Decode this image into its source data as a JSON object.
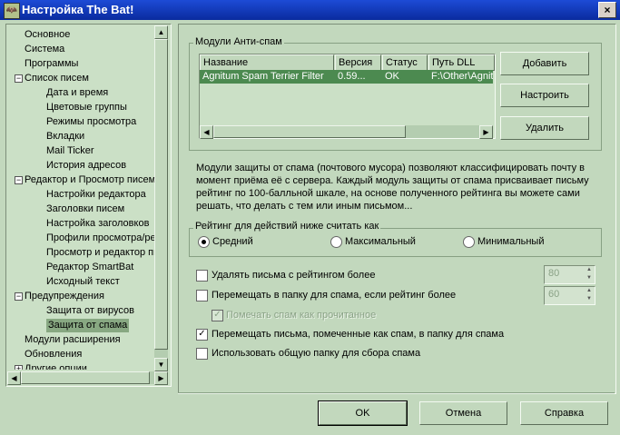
{
  "window": {
    "title": "Настройка The Bat!",
    "icon": "bat-app-icon",
    "close_label": "×"
  },
  "tree": {
    "items": [
      {
        "label": "Основное",
        "level": 0,
        "expander": ""
      },
      {
        "label": "Система",
        "level": 0,
        "expander": ""
      },
      {
        "label": "Программы",
        "level": 0,
        "expander": ""
      },
      {
        "label": "Список писем",
        "level": 0,
        "expander": "−"
      },
      {
        "label": "Дата и время",
        "level": 1,
        "expander": ""
      },
      {
        "label": "Цветовые группы",
        "level": 1,
        "expander": ""
      },
      {
        "label": "Режимы просмотра",
        "level": 1,
        "expander": ""
      },
      {
        "label": "Вкладки",
        "level": 1,
        "expander": ""
      },
      {
        "label": "Mail Ticker",
        "level": 1,
        "expander": ""
      },
      {
        "label": "История адресов",
        "level": 1,
        "expander": ""
      },
      {
        "label": "Редактор и Просмотр писем",
        "level": 0,
        "expander": "−"
      },
      {
        "label": "Настройки редактора",
        "level": 1,
        "expander": ""
      },
      {
        "label": "Заголовки писем",
        "level": 1,
        "expander": ""
      },
      {
        "label": "Настройка заголовков",
        "level": 1,
        "expander": ""
      },
      {
        "label": "Профили просмотра/редактора",
        "level": 1,
        "expander": ""
      },
      {
        "label": "Просмотр и редактор писем",
        "level": 1,
        "expander": ""
      },
      {
        "label": "Редактор SmartBat",
        "level": 1,
        "expander": ""
      },
      {
        "label": "Исходный текст",
        "level": 1,
        "expander": ""
      },
      {
        "label": "Предупреждения",
        "level": 0,
        "expander": "−"
      },
      {
        "label": "Защита от вирусов",
        "level": 1,
        "expander": ""
      },
      {
        "label": "Защита от спама",
        "level": 1,
        "expander": "",
        "selected": true
      },
      {
        "label": "Модули расширения",
        "level": 0,
        "expander": ""
      },
      {
        "label": "Обновления",
        "level": 0,
        "expander": ""
      },
      {
        "label": "Другие опции",
        "level": 0,
        "expander": "+"
      }
    ]
  },
  "antispam": {
    "group_label": "Модули Анти-спам",
    "columns": [
      "Название",
      "Версия",
      "Статус",
      "Путь DLL"
    ],
    "rows": [
      {
        "name": "Agnitum Spam Terrier Filter",
        "version": "0.59...",
        "status": "OK",
        "path": "F:\\Other\\Agnitum"
      }
    ],
    "buttons": {
      "add": "Добавить",
      "configure": "Настроить",
      "remove": "Удалить"
    }
  },
  "description": "Модули защиты от спама (почтового мусора) позволяют классифицировать почту в момент приёма её с сервера. Каждый модуль защиты от спама присваивает письму рейтинг по 100-балльной шкале, на основе полученного рейтинга вы можете сами решать, что делать с тем или иным письмом...",
  "rating": {
    "group_label": "Рейтинг для действий ниже считать как",
    "options": [
      "Средний",
      "Максимальный",
      "Минимальный"
    ],
    "selected": "Средний"
  },
  "options": {
    "delete_label": "Удалять письма с рейтингом более",
    "delete_checked": false,
    "delete_value": "80",
    "move_label": "Перемещать в папку для спама, если рейтинг более",
    "move_checked": false,
    "move_value": "60",
    "mark_read_label": "Помечать спам как прочитанное",
    "mark_read_checked": true,
    "move_marked_label": "Перемещать письма, помеченные как спам, в папку для спама",
    "move_marked_checked": true,
    "shared_folder_label": "Использовать общую папку для сбора спама",
    "shared_folder_checked": false
  },
  "footer": {
    "ok": "OK",
    "cancel": "Отмена",
    "help": "Справка"
  },
  "colors": {
    "background": "#c2d8bd",
    "selection": "#4c8a50",
    "titlebar": "#0a2b9e"
  }
}
